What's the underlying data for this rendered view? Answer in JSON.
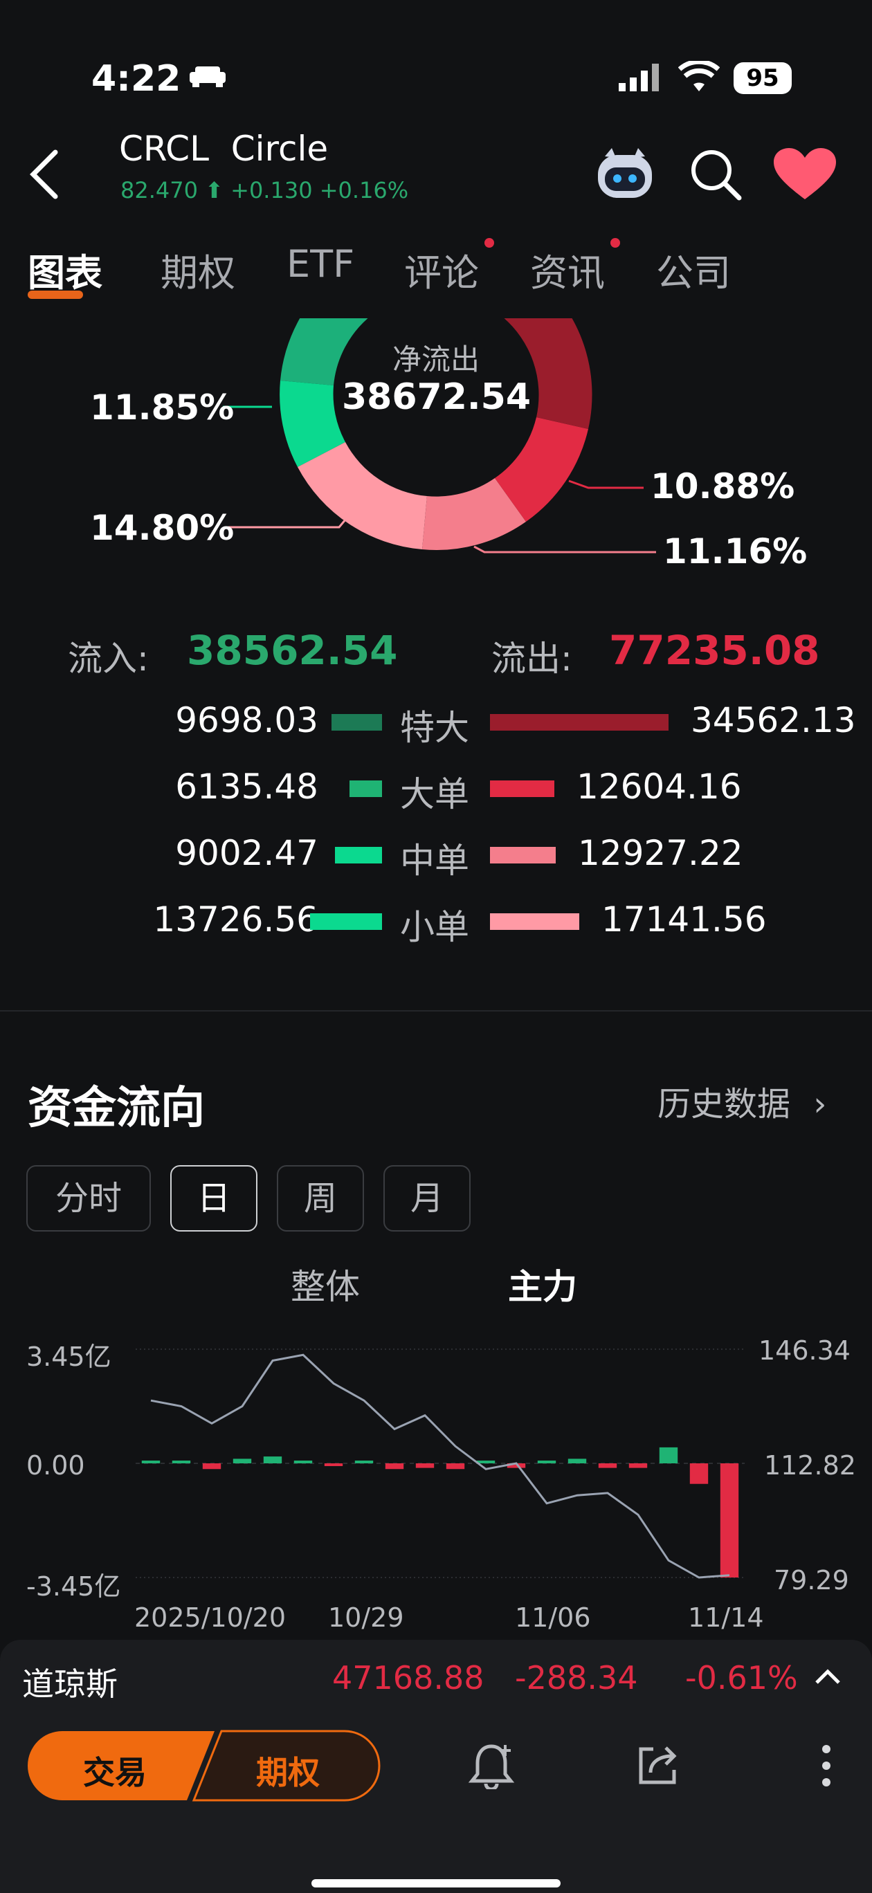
{
  "status": {
    "time": "4:22",
    "battery": "95"
  },
  "header": {
    "symbol": "CRCL",
    "name": "Circle",
    "price": "82.470",
    "change": "+0.130",
    "pct": "+0.16%"
  },
  "tabs": [
    {
      "label": "图表"
    },
    {
      "label": "期权"
    },
    {
      "label": "ETF"
    },
    {
      "label": "评论"
    },
    {
      "label": "资讯"
    },
    {
      "label": "公司"
    }
  ],
  "donut": {
    "center_title": "净流出",
    "center_value": "38672.54",
    "label_left_top": "11.85%",
    "label_left_bottom": "14.80%",
    "label_right_top": "10.88%",
    "label_right_bottom": "11.16%"
  },
  "flows": {
    "inflow_label": "流入:",
    "inflow_value": "38562.54",
    "outflow_label": "流出:",
    "outflow_value": "77235.08",
    "rows": [
      {
        "in": "9698.03",
        "label": "特大",
        "out": "34562.13",
        "in_frac": 0.28,
        "out_frac": 1.0
      },
      {
        "in": "6135.48",
        "label": "大单",
        "out": "12604.16",
        "in_frac": 0.18,
        "out_frac": 0.36
      },
      {
        "in": "9002.47",
        "label": "中单",
        "out": "12927.22",
        "in_frac": 0.26,
        "out_frac": 0.37
      },
      {
        "in": "13726.56",
        "label": "小单",
        "out": "17141.56",
        "in_frac": 0.4,
        "out_frac": 0.5
      }
    ]
  },
  "capital": {
    "title": "资金流向",
    "history": "历史数据",
    "segments": [
      "分时",
      "日",
      "周",
      "月"
    ],
    "modes": [
      "整体",
      "主力"
    ]
  },
  "chart_data": {
    "type": "bar",
    "x_ticks": [
      "2025/10/20",
      "10/29",
      "11/06",
      "11/14"
    ],
    "y_left": [
      "3.45亿",
      "0.00",
      "-3.45亿"
    ],
    "y_right": [
      "146.34",
      "112.82",
      "79.29"
    ],
    "bars": [
      0.02,
      0.01,
      -0.05,
      0.04,
      0.06,
      0.02,
      -0.02,
      0.02,
      -0.05,
      -0.04,
      -0.05,
      0.02,
      -0.04,
      0.02,
      0.04,
      -0.04,
      -0.04,
      0.14,
      -0.18,
      -1.0
    ],
    "line": [
      0.55,
      0.5,
      0.35,
      0.5,
      0.9,
      0.95,
      0.7,
      0.55,
      0.3,
      0.42,
      0.15,
      -0.05,
      0.0,
      -0.35,
      -0.28,
      -0.26,
      -0.45,
      -0.85,
      -1.0,
      -0.98
    ]
  },
  "index": {
    "name": "道琼斯",
    "value": "47168.88",
    "change": "-288.34",
    "pct": "-0.61%"
  },
  "toolbar": {
    "trade": "交易",
    "options": "期权"
  },
  "colors": {
    "green": "#2aa86d",
    "red": "#e22b44",
    "dark_red": "#9a1d2c",
    "pink": "#f47e8c",
    "light_pink": "#ff9aa5"
  }
}
